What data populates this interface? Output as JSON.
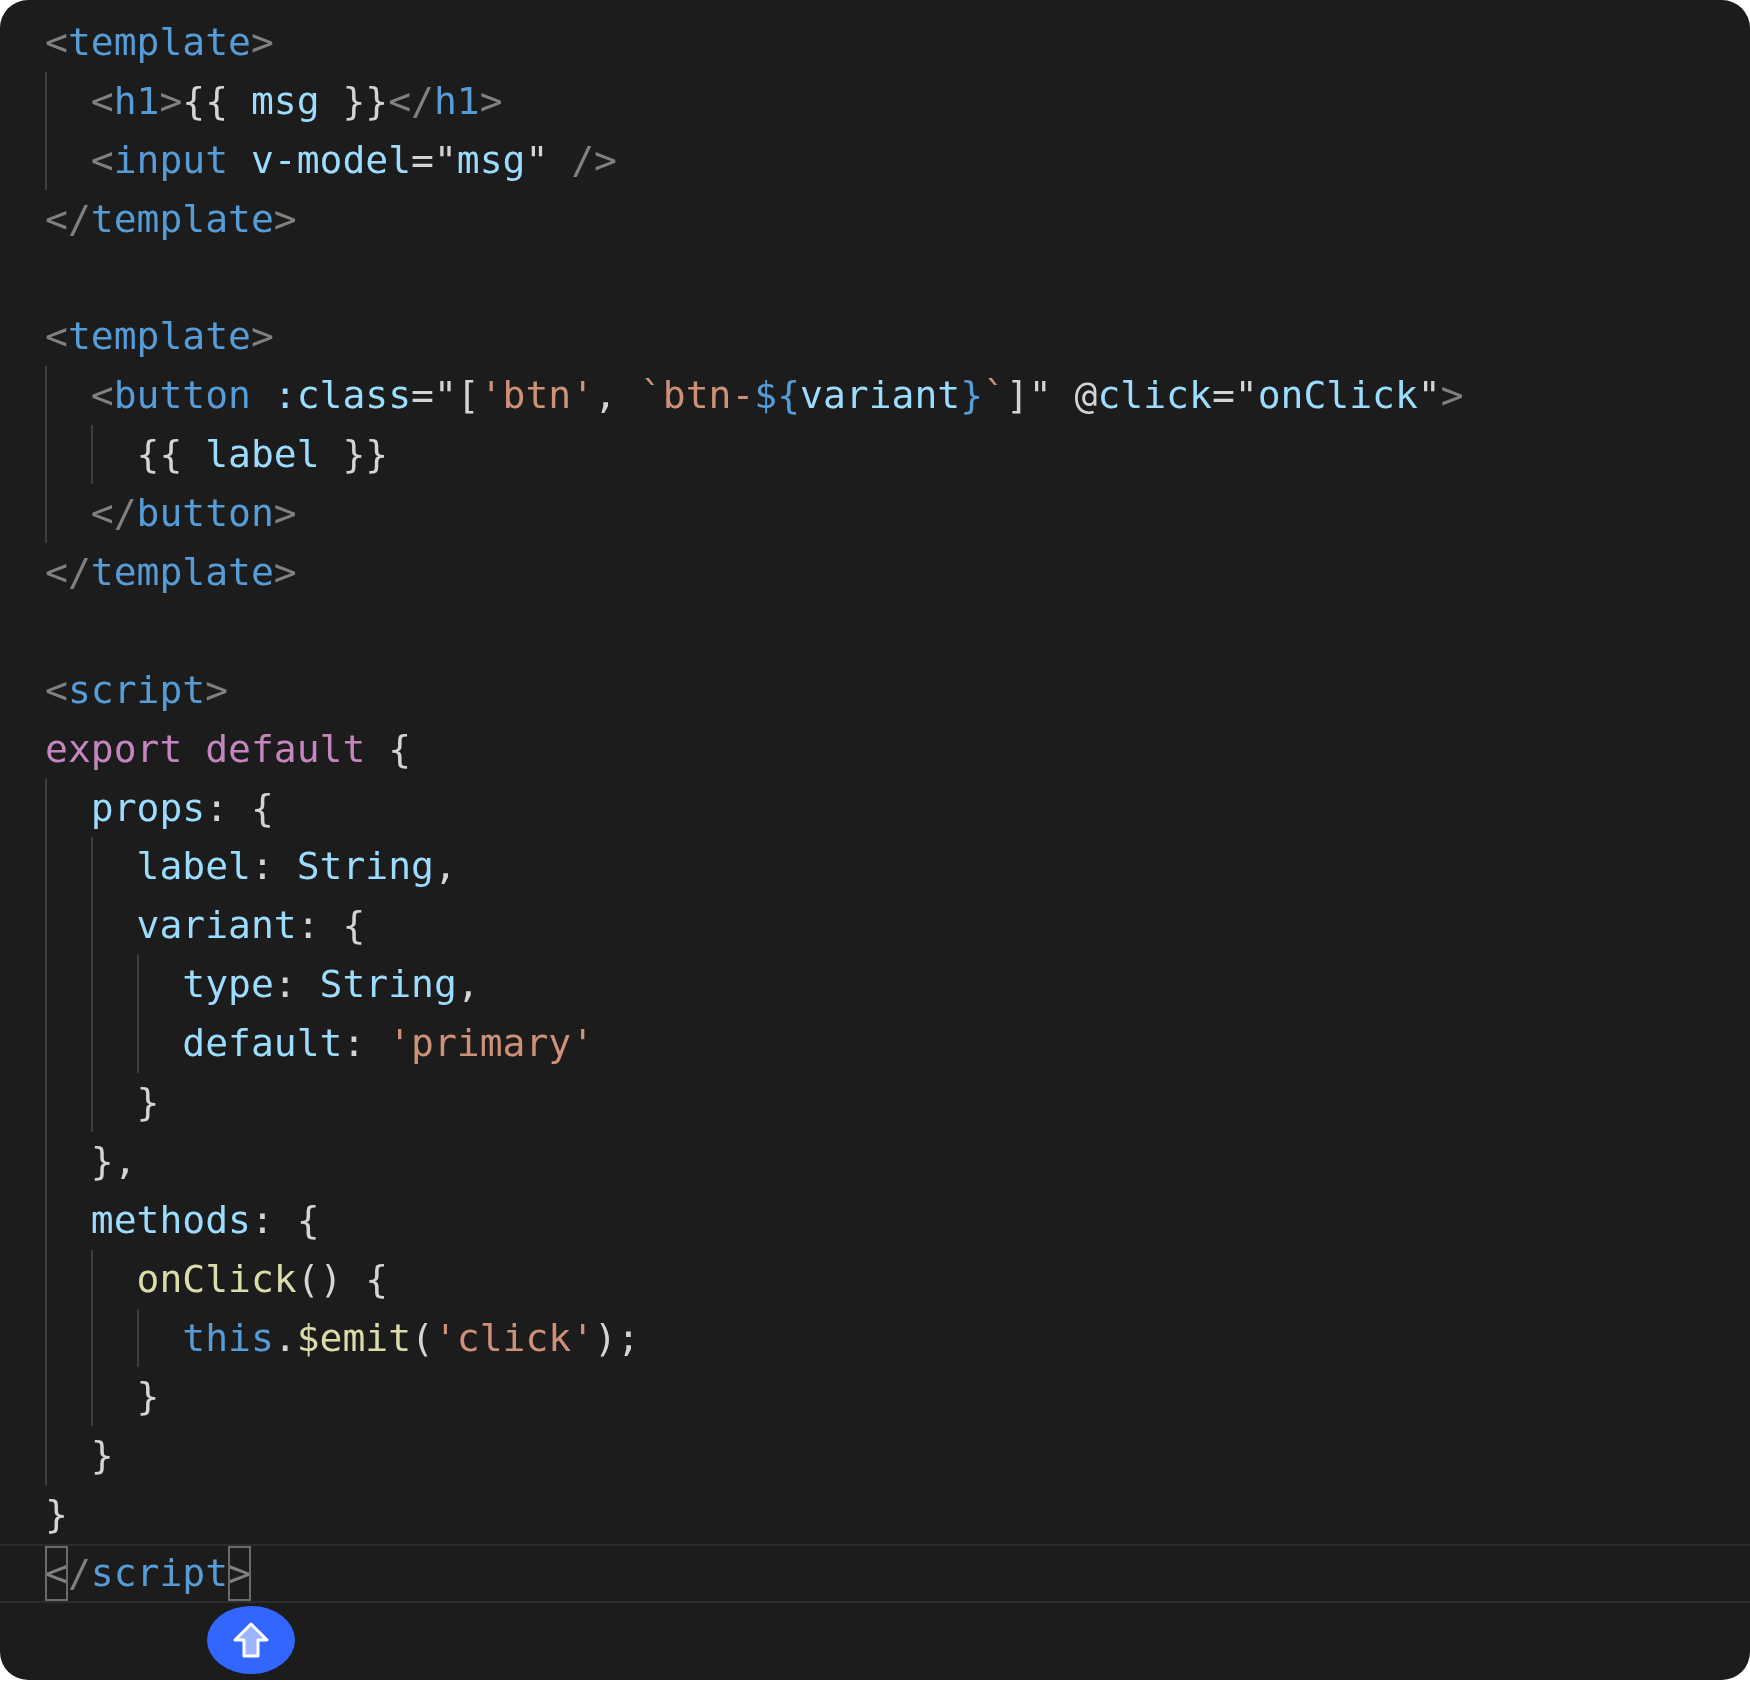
{
  "editor": {
    "lines": [
      {
        "kind": "code",
        "current": false,
        "tokens": [
          {
            "kind": "punct",
            "text": "<"
          },
          {
            "kind": "tag",
            "text": "template"
          },
          {
            "kind": "punct",
            "text": ">"
          }
        ]
      },
      {
        "kind": "code",
        "current": false,
        "tokens": [
          {
            "kind": "punct",
            "text": "  <"
          },
          {
            "kind": "tag",
            "text": "h1"
          },
          {
            "kind": "punct",
            "text": ">"
          },
          {
            "kind": "plain",
            "text": "{{ "
          },
          {
            "kind": "attr",
            "text": "msg"
          },
          {
            "kind": "plain",
            "text": " }}"
          },
          {
            "kind": "punct",
            "text": "</"
          },
          {
            "kind": "tag",
            "text": "h1"
          },
          {
            "kind": "punct",
            "text": ">"
          }
        ]
      },
      {
        "kind": "code",
        "current": false,
        "tokens": [
          {
            "kind": "punct",
            "text": "  <"
          },
          {
            "kind": "tag",
            "text": "input"
          },
          {
            "kind": "attr",
            "text": " v-model"
          },
          {
            "kind": "plain",
            "text": "=\""
          },
          {
            "kind": "attr",
            "text": "msg"
          },
          {
            "kind": "plain",
            "text": "\" "
          },
          {
            "kind": "punct",
            "text": "/>"
          }
        ]
      },
      {
        "kind": "code",
        "current": false,
        "tokens": [
          {
            "kind": "punct",
            "text": "</"
          },
          {
            "kind": "tag",
            "text": "template"
          },
          {
            "kind": "punct",
            "text": ">"
          }
        ]
      },
      {
        "kind": "blank",
        "current": false
      },
      {
        "kind": "code",
        "current": false,
        "tokens": [
          {
            "kind": "punct",
            "text": "<"
          },
          {
            "kind": "tag",
            "text": "template"
          },
          {
            "kind": "punct",
            "text": ">"
          }
        ]
      },
      {
        "kind": "code",
        "current": false,
        "tokens": [
          {
            "kind": "punct",
            "text": "  <"
          },
          {
            "kind": "tag",
            "text": "button"
          },
          {
            "kind": "attr",
            "text": " :class"
          },
          {
            "kind": "plain",
            "text": "=\"["
          },
          {
            "kind": "string",
            "text": "'btn'"
          },
          {
            "kind": "plain",
            "text": ", "
          },
          {
            "kind": "string",
            "text": "`btn-"
          },
          {
            "kind": "tag",
            "text": "${"
          },
          {
            "kind": "attr",
            "text": "variant"
          },
          {
            "kind": "tag",
            "text": "}"
          },
          {
            "kind": "string",
            "text": "`"
          },
          {
            "kind": "plain",
            "text": "]\" @"
          },
          {
            "kind": "attr",
            "text": "click"
          },
          {
            "kind": "plain",
            "text": "=\""
          },
          {
            "kind": "attr",
            "text": "onClick"
          },
          {
            "kind": "plain",
            "text": "\""
          },
          {
            "kind": "punct",
            "text": ">"
          }
        ]
      },
      {
        "kind": "code",
        "current": false,
        "tokens": [
          {
            "kind": "plain",
            "text": "    {{ "
          },
          {
            "kind": "attr",
            "text": "label"
          },
          {
            "kind": "plain",
            "text": " }}"
          }
        ]
      },
      {
        "kind": "code",
        "current": false,
        "tokens": [
          {
            "kind": "punct",
            "text": "  </"
          },
          {
            "kind": "tag",
            "text": "button"
          },
          {
            "kind": "punct",
            "text": ">"
          }
        ]
      },
      {
        "kind": "code",
        "current": false,
        "tokens": [
          {
            "kind": "punct",
            "text": "</"
          },
          {
            "kind": "tag",
            "text": "template"
          },
          {
            "kind": "punct",
            "text": ">"
          }
        ]
      },
      {
        "kind": "blank",
        "current": false
      },
      {
        "kind": "code",
        "current": false,
        "tokens": [
          {
            "kind": "punct",
            "text": "<"
          },
          {
            "kind": "tag",
            "text": "script"
          },
          {
            "kind": "punct",
            "text": ">"
          }
        ]
      },
      {
        "kind": "code",
        "current": false,
        "tokens": [
          {
            "kind": "keyword",
            "text": "export default"
          },
          {
            "kind": "plain",
            "text": " {"
          }
        ]
      },
      {
        "kind": "code",
        "current": false,
        "tokens": [
          {
            "kind": "attr",
            "text": "  props"
          },
          {
            "kind": "plain",
            "text": ": {"
          }
        ]
      },
      {
        "kind": "code",
        "current": false,
        "tokens": [
          {
            "kind": "attr",
            "text": "    label"
          },
          {
            "kind": "plain",
            "text": ": "
          },
          {
            "kind": "attr",
            "text": "String"
          },
          {
            "kind": "plain",
            "text": ","
          }
        ]
      },
      {
        "kind": "code",
        "current": false,
        "tokens": [
          {
            "kind": "attr",
            "text": "    variant"
          },
          {
            "kind": "plain",
            "text": ": {"
          }
        ]
      },
      {
        "kind": "code",
        "current": false,
        "tokens": [
          {
            "kind": "attr",
            "text": "      type"
          },
          {
            "kind": "plain",
            "text": ": "
          },
          {
            "kind": "attr",
            "text": "String"
          },
          {
            "kind": "plain",
            "text": ","
          }
        ]
      },
      {
        "kind": "code",
        "current": false,
        "tokens": [
          {
            "kind": "attr",
            "text": "      default"
          },
          {
            "kind": "plain",
            "text": ": "
          },
          {
            "kind": "string",
            "text": "'primary'"
          }
        ]
      },
      {
        "kind": "code",
        "current": false,
        "tokens": [
          {
            "kind": "plain",
            "text": "    }"
          }
        ]
      },
      {
        "kind": "code",
        "current": false,
        "tokens": [
          {
            "kind": "plain",
            "text": "  },"
          }
        ]
      },
      {
        "kind": "code",
        "current": false,
        "tokens": [
          {
            "kind": "attr",
            "text": "  methods"
          },
          {
            "kind": "plain",
            "text": ": {"
          }
        ]
      },
      {
        "kind": "code",
        "current": false,
        "tokens": [
          {
            "kind": "function",
            "text": "    onClick"
          },
          {
            "kind": "plain",
            "text": "() {"
          }
        ]
      },
      {
        "kind": "code",
        "current": false,
        "tokens": [
          {
            "kind": "tag",
            "text": "      this"
          },
          {
            "kind": "plain",
            "text": "."
          },
          {
            "kind": "function",
            "text": "$emit"
          },
          {
            "kind": "plain",
            "text": "("
          },
          {
            "kind": "string",
            "text": "'click'"
          },
          {
            "kind": "plain",
            "text": ");"
          }
        ]
      },
      {
        "kind": "code",
        "current": false,
        "tokens": [
          {
            "kind": "plain",
            "text": "    }"
          }
        ]
      },
      {
        "kind": "code",
        "current": false,
        "tokens": [
          {
            "kind": "plain",
            "text": "  }"
          }
        ]
      },
      {
        "kind": "code",
        "current": false,
        "tokens": [
          {
            "kind": "plain",
            "text": "}"
          }
        ]
      },
      {
        "kind": "code",
        "current": true,
        "tokens": [
          {
            "kind": "match",
            "text": "<"
          },
          {
            "kind": "punct",
            "text": "/"
          },
          {
            "kind": "tag",
            "text": "script"
          },
          {
            "kind": "match",
            "text": ">"
          }
        ]
      }
    ]
  }
}
